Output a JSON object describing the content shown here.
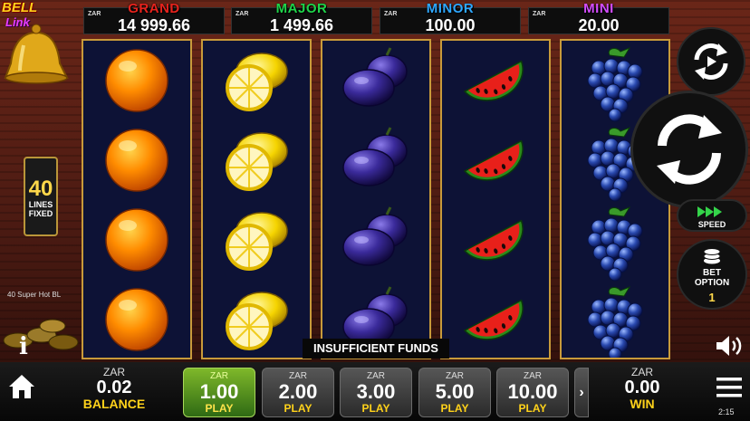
{
  "game": {
    "logo_title": "BELL",
    "logo_subtitle": "Link",
    "name": "40 Super Hot BL"
  },
  "jackpots": [
    {
      "currency": "ZAR",
      "name": "GRAND",
      "amount": "14 999.66",
      "color": "#e8231d"
    },
    {
      "currency": "ZAR",
      "name": "MAJOR",
      "amount": "1 499.66",
      "color": "#1fd44a"
    },
    {
      "currency": "ZAR",
      "name": "MINOR",
      "amount": "100.00",
      "color": "#2fa8ff"
    },
    {
      "currency": "ZAR",
      "name": "MINI",
      "amount": "20.00",
      "color": "#d44dff"
    }
  ],
  "reels": [
    {
      "symbol": "orange-icon",
      "rows": 4
    },
    {
      "symbol": "lemon-icon",
      "rows": 4
    },
    {
      "symbol": "plum-icon",
      "rows": 4
    },
    {
      "symbol": "watermelon-icon",
      "rows": 4
    },
    {
      "symbol": "grapes-icon",
      "rows": 4
    }
  ],
  "lines": {
    "count": "40",
    "label1": "LINES",
    "label2": "FIXED"
  },
  "message": "INSUFFICIENT FUNDS",
  "controls": {
    "autoplay_icon": "autoplay-icon",
    "spin_icon": "spin-icon",
    "speed_label": "SPEED",
    "bet_option_label1": "BET",
    "bet_option_label2": "OPTION",
    "bet_option_value": "1"
  },
  "balance": {
    "currency": "ZAR",
    "value": "0.02",
    "label": "BALANCE"
  },
  "win": {
    "currency": "ZAR",
    "value": "0.00",
    "label": "WIN"
  },
  "bets": [
    {
      "currency": "ZAR",
      "value": "1.00",
      "label": "PLAY",
      "active": true
    },
    {
      "currency": "ZAR",
      "value": "2.00",
      "label": "PLAY",
      "active": false
    },
    {
      "currency": "ZAR",
      "value": "3.00",
      "label": "PLAY",
      "active": false
    },
    {
      "currency": "ZAR",
      "value": "5.00",
      "label": "PLAY",
      "active": false
    },
    {
      "currency": "ZAR",
      "value": "10.00",
      "label": "PLAY",
      "active": false
    }
  ],
  "more_bets_glyph": "›",
  "info_glyph": "i",
  "clock": "2:15"
}
